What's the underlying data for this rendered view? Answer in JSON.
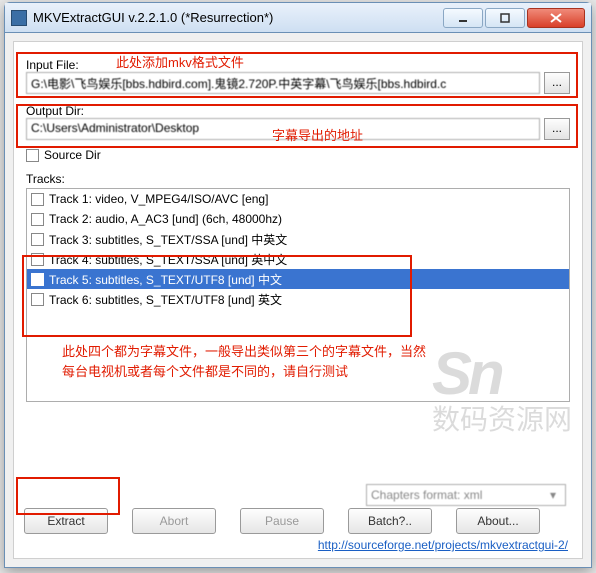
{
  "window": {
    "title": "MKVExtractGUI v.2.2.1.0 (*Resurrection*)"
  },
  "input": {
    "label": "Input File:",
    "value": "G:\\电影\\飞鸟娱乐[bbs.hdbird.com].鬼镜2.720P.中英字幕\\飞鸟娱乐[bbs.hdbird.c"
  },
  "output": {
    "label": "Output Dir:",
    "value": "C:\\Users\\Administrator\\Desktop"
  },
  "source_dir": {
    "label": "Source Dir",
    "checked": false
  },
  "tracks": {
    "label": "Tracks:",
    "items": [
      {
        "text": "Track 1: video, V_MPEG4/ISO/AVC [eng]",
        "checked": false,
        "selected": false
      },
      {
        "text": "Track 2: audio, A_AC3 [und]  (6ch, 48000hz)",
        "checked": false,
        "selected": false
      },
      {
        "text": "Track 3: subtitles, S_TEXT/SSA [und] 中英文",
        "checked": false,
        "selected": false
      },
      {
        "text": "Track 4: subtitles, S_TEXT/SSA [und] 英中文",
        "checked": false,
        "selected": false
      },
      {
        "text": "Track 5: subtitles, S_TEXT/UTF8 [und] 中文",
        "checked": true,
        "selected": true
      },
      {
        "text": "Track 6: subtitles, S_TEXT/UTF8 [und] 英文",
        "checked": false,
        "selected": false
      }
    ]
  },
  "combo": {
    "value": "Chapters format: xml"
  },
  "buttons": {
    "extract": "Extract",
    "abort": "Abort",
    "pause": "Pause",
    "batch": "Batch?..",
    "about": "About..."
  },
  "link": "http://sourceforge.net/projects/mkvextractgui-2/",
  "annotations": {
    "a1": "此处添加mkv格式文件",
    "a2": "字幕导出的地址",
    "a3": "此处四个都为字幕文件，一般导出类似第三个的字幕文件，当然每台电视机或者每个文件都是不同的，请自行测试"
  },
  "watermark": {
    "logo": "Sn",
    "text": "数码资源网"
  }
}
